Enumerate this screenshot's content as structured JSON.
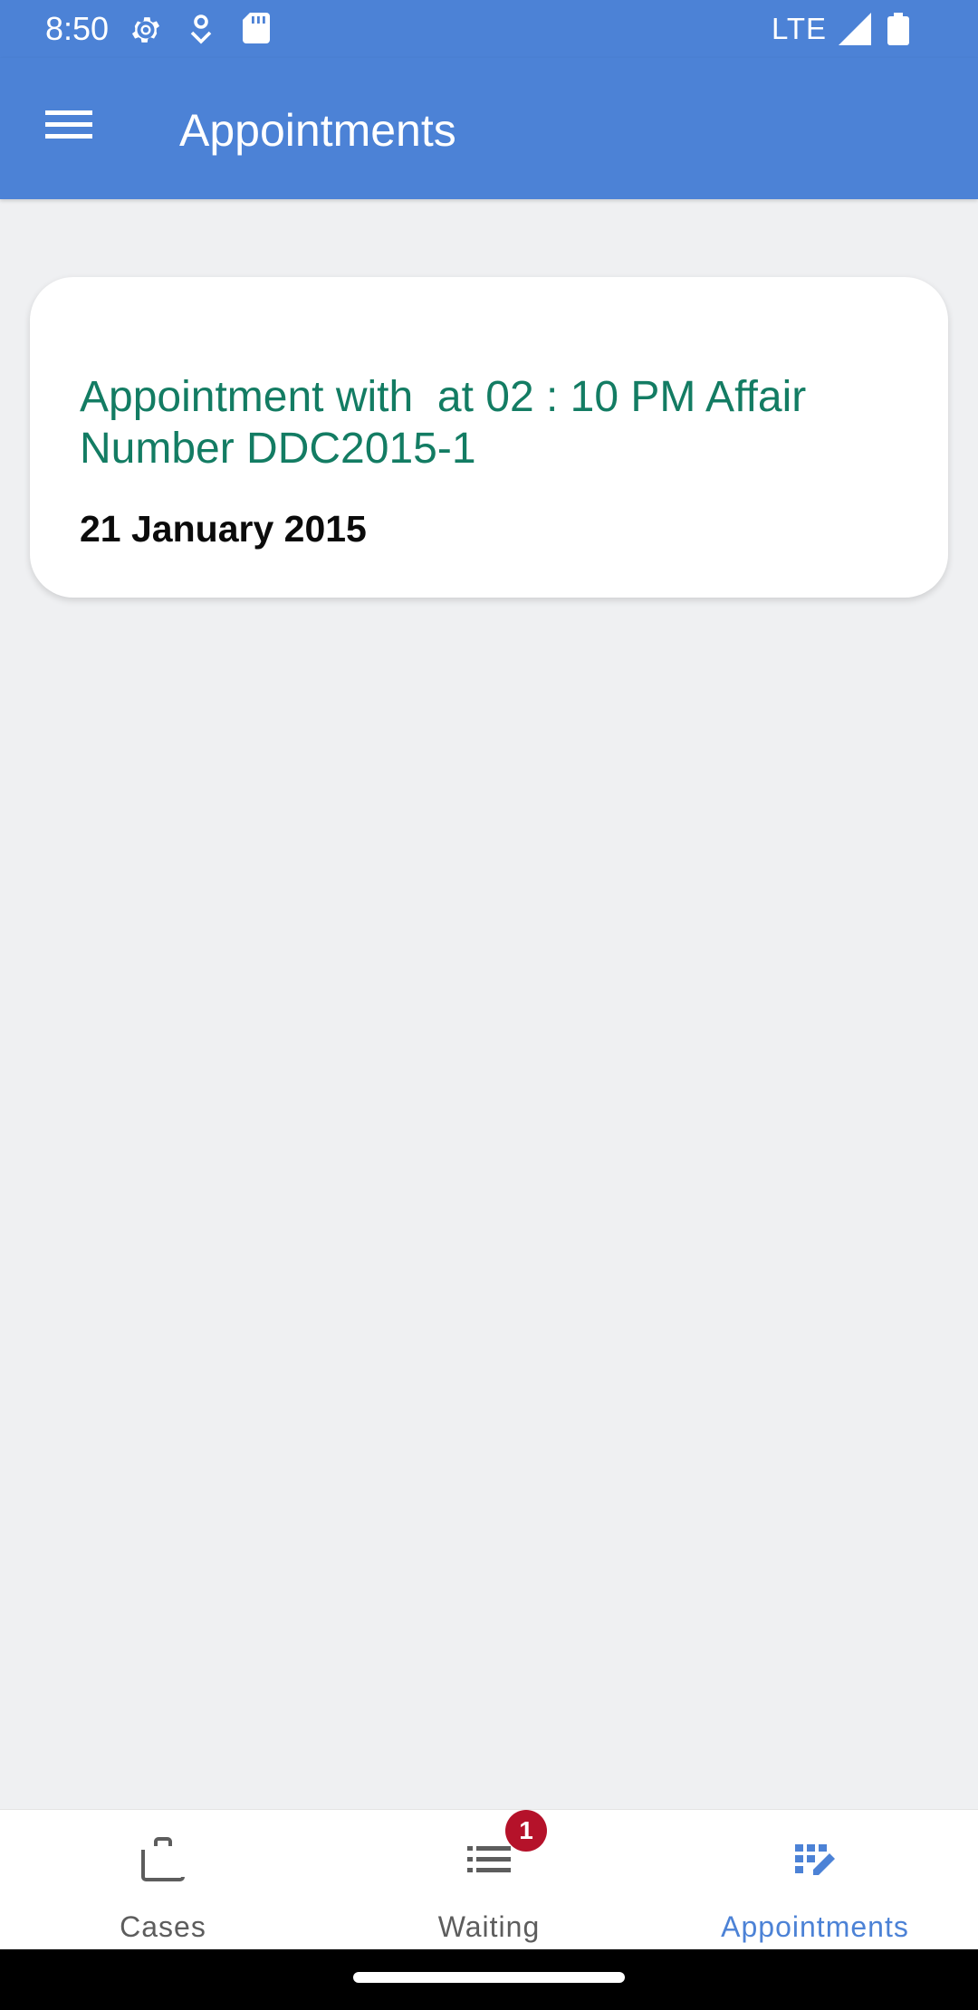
{
  "status_bar": {
    "time": "8:50",
    "network": "LTE",
    "icons": [
      "settings-gear-icon",
      "location-icon",
      "sd-card-icon",
      "signal-icon",
      "battery-icon"
    ]
  },
  "app_bar": {
    "title": "Appointments",
    "background_color": "#4c82d6",
    "menu_icon": "menu-icon"
  },
  "appointments": [
    {
      "title": "Appointment with  at 02 : 10 PM Affair Number DDC2015-1",
      "date": "21 January 2015",
      "title_color": "#137c63"
    }
  ],
  "bottom_nav": {
    "items": [
      {
        "label": "Cases",
        "icon": "briefcase-icon",
        "active": false
      },
      {
        "label": "Waiting",
        "icon": "list-icon",
        "active": false,
        "badge": "1"
      },
      {
        "label": "Appointments",
        "icon": "calendar-edit-icon",
        "active": true
      }
    ],
    "active_color": "#4c82d6",
    "badge_color": "#b5122a"
  }
}
